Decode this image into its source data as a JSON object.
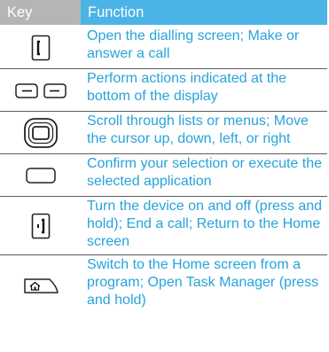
{
  "header": {
    "key_label": "Key",
    "function_label": "Function"
  },
  "rows": [
    {
      "icon": "dial-key-icon",
      "text": "Open the dialling screen; Make or answer a call"
    },
    {
      "icon": "soft-keys-icon",
      "text": "Perform actions indicated at the bottom of the display"
    },
    {
      "icon": "navigation-key-icon",
      "text": "Scroll through lists or menus; Move the cursor up, down, left, or right"
    },
    {
      "icon": "confirm-key-icon",
      "text": "Confirm your selection or execute the selected application"
    },
    {
      "icon": "power-end-key-icon",
      "text": "Turn the device on and off (press and hold); End a call; Return to the Home screen"
    },
    {
      "icon": "home-key-icon",
      "text": "Switch to the Home screen from a program; Open Task Manager (press and hold)"
    }
  ],
  "colors": {
    "header_key_bg": "#b5b5b5",
    "header_function_bg": "#4bb4e6",
    "function_text": "#27a3dc",
    "divider": "#5c5c5c"
  }
}
